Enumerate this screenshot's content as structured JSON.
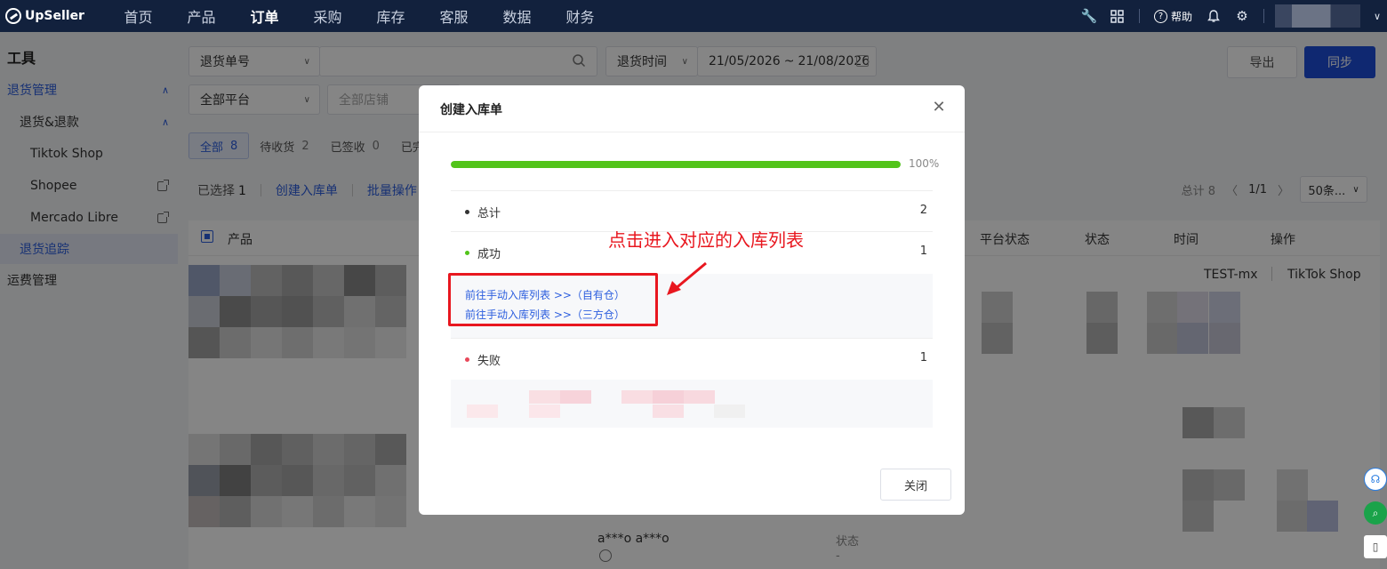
{
  "app": {
    "brand": "UpSeller"
  },
  "nav": {
    "items": [
      {
        "label": "首页",
        "active": false
      },
      {
        "label": "产品",
        "active": false
      },
      {
        "label": "订单",
        "active": true
      },
      {
        "label": "采购",
        "active": false
      },
      {
        "label": "库存",
        "active": false
      },
      {
        "label": "客服",
        "active": false
      },
      {
        "label": "数据",
        "active": false
      },
      {
        "label": "财务",
        "active": false
      }
    ],
    "help_label": "帮助"
  },
  "sidebar": {
    "title": "工具",
    "items": [
      {
        "label": "退货管理"
      },
      {
        "label": "退货&退款"
      },
      {
        "label": "Tiktok Shop"
      },
      {
        "label": "Shopee"
      },
      {
        "label": "Mercado Libre"
      },
      {
        "label": "退货追踪"
      },
      {
        "label": "运费管理"
      }
    ]
  },
  "filters": {
    "search_field": "退货单号",
    "time_field": "退货时间",
    "date_start": "21/05/2026",
    "date_sep": "~",
    "date_end": "21/08/2026",
    "platform": "全部平台",
    "shop_placeholder": "全部店铺"
  },
  "actions": {
    "export": "导出",
    "sync": "同步"
  },
  "status_tabs": [
    {
      "label": "全部",
      "count": "8"
    },
    {
      "label": "待收货",
      "count": "2"
    },
    {
      "label": "已签收",
      "count": "0"
    },
    {
      "label": "已完"
    }
  ],
  "toolbar": {
    "selected_label": "已选择",
    "selected_count": "1",
    "create_inbound": "创建入库单",
    "batch_ops": "批量操作"
  },
  "pager": {
    "total": "总计 8",
    "page": "1/1",
    "page_size": "50条..."
  },
  "table": {
    "headers": {
      "product": "产品",
      "platform_status": "平台状态",
      "status": "状态",
      "time": "时间",
      "actions": "操作"
    },
    "row1_shop": "TEST-mx",
    "row1_platform": "TikTok Shop",
    "bottom_name": "a***o a***o",
    "bottom_status_label": "状态",
    "bottom_status_value": "-"
  },
  "modal": {
    "title": "创建入库单",
    "progress_percent": 100,
    "progress_label": "100%",
    "total_label": "总计",
    "total_value": "2",
    "success_label": "成功",
    "success_value": "1",
    "link_own": "前往手动入库列表 >>（自有仓）",
    "link_third": "前往手动入库列表 >>（三方仓）",
    "fail_label": "失败",
    "fail_value": "1",
    "close_button": "关闭"
  },
  "annotation": {
    "text": "点击进入对应的入库列表"
  },
  "colors": {
    "topbar": "#12213d",
    "primary": "#1d4ed8",
    "link": "#2c5ede",
    "success": "#52c41a",
    "fail": "#e8485a",
    "annotation": "#e8171f"
  }
}
